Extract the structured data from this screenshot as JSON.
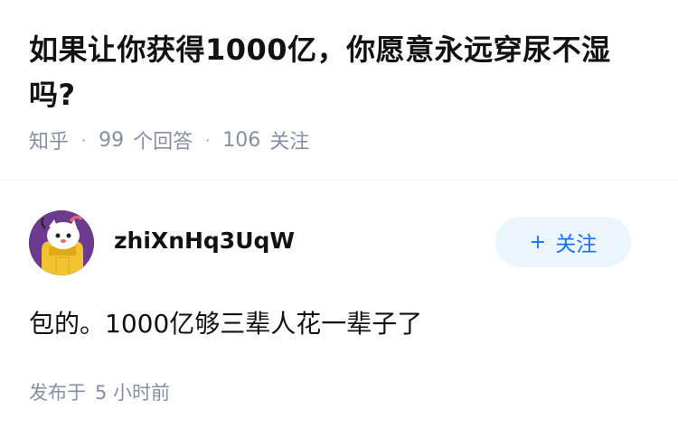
{
  "question": {
    "title": "如果让你获得1000亿，你愿意永远穿尿不湿吗?",
    "source": "知乎",
    "answers_count": "99",
    "answers_label": "个回答",
    "followers_count": "106",
    "followers_label": "关注"
  },
  "answer": {
    "author_name": "zhiXnHq3UqW",
    "follow_label": "关注",
    "follow_icon": "plus-icon",
    "content": "包的。1000亿够三辈人花一辈子了",
    "time_prefix": "发布于",
    "time_value": "5 小时前"
  },
  "colors": {
    "text_primary": "#121212",
    "text_secondary": "#8590a6",
    "accent": "#1772f6",
    "follow_bg": "#ebf5fd",
    "avatar_bg": "#6c3a8f"
  }
}
